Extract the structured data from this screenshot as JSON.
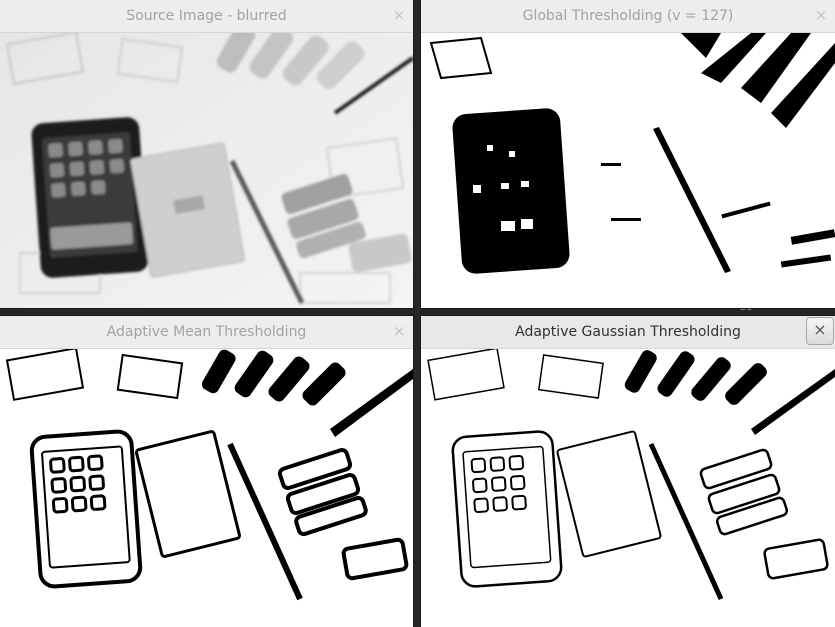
{
  "windows": {
    "source": {
      "title": "Source Image - blurred",
      "close": "×"
    },
    "global": {
      "title": "Global Thresholding (v = 127)",
      "close": "×"
    },
    "mean": {
      "title": "Adaptive Mean Thresholding",
      "close": "×"
    },
    "gaussian": {
      "title": "Adaptive Gaussian Thresholding",
      "close": "×"
    }
  },
  "background_text": "21",
  "colors": {
    "titlebar_inactive": "#ededeb",
    "titlebar_active": "#e8e8e7",
    "title_inactive_text": "#a3a3a3",
    "title_active_text": "#2e3436"
  }
}
